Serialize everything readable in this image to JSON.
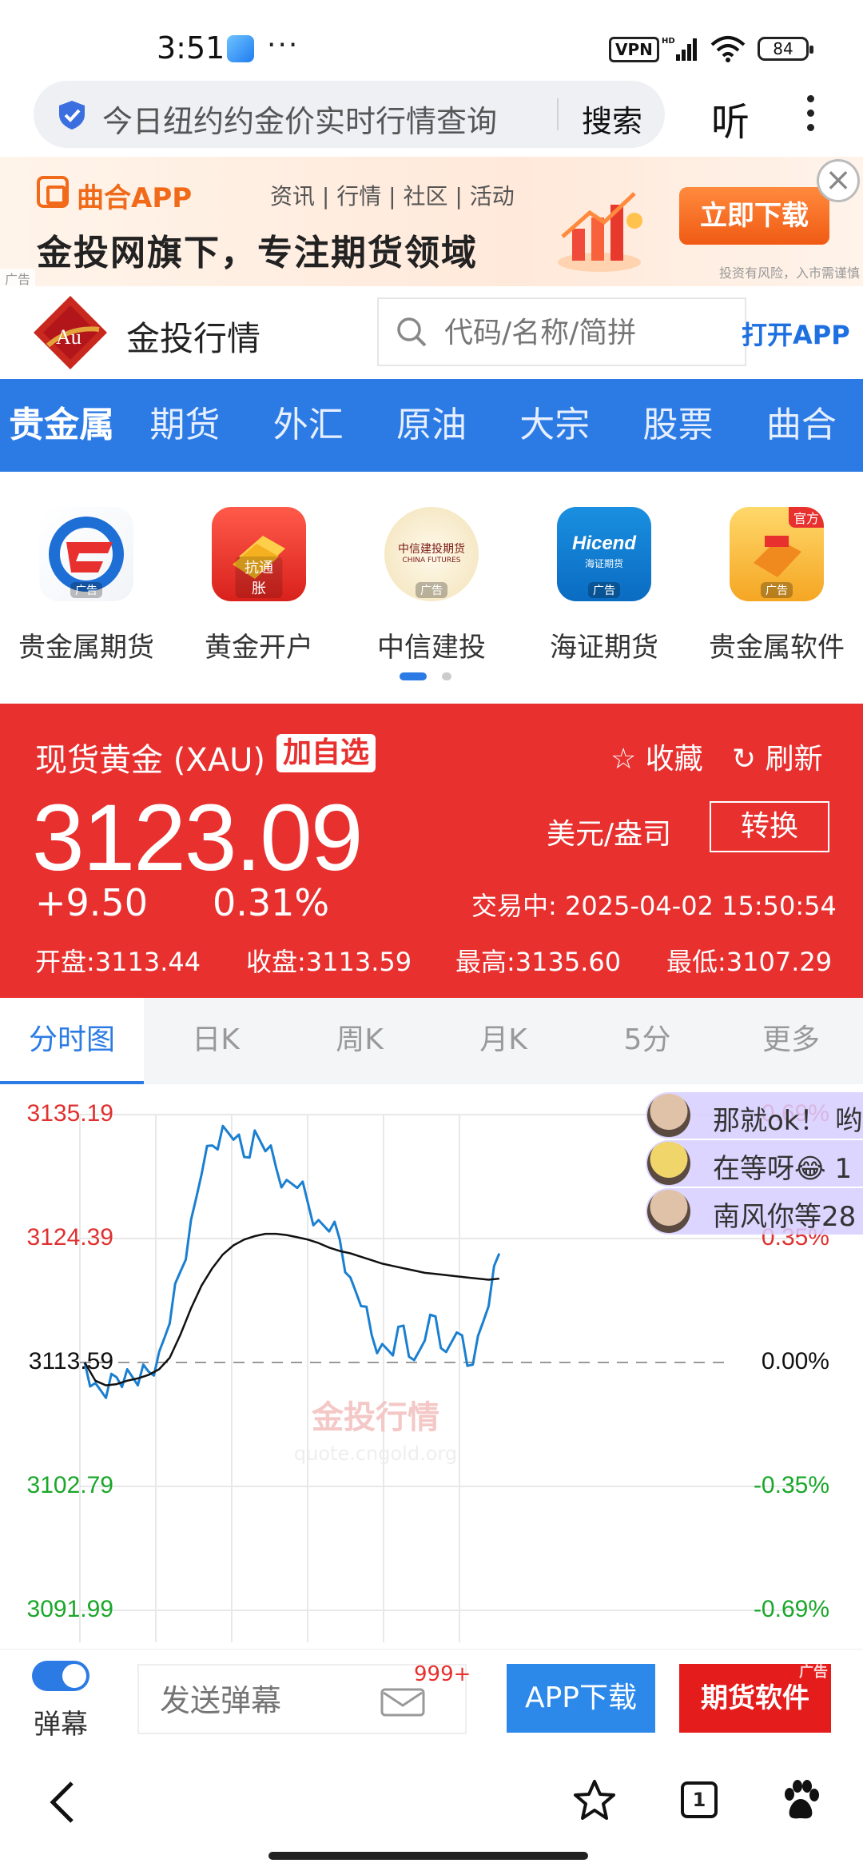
{
  "status_bar": {
    "time": "3:51",
    "dots": "···",
    "vpn": "VPN",
    "battery": "84"
  },
  "browser": {
    "query": "今日纽约约金价实时行情查询",
    "search_label": "搜索",
    "listen_label": "听"
  },
  "ad_banner": {
    "brand": "曲合APP",
    "tags": "资讯 | 行情 | 社区 | 活动",
    "slogan": "金投网旗下，专注期货领域",
    "cta": "立即下载",
    "ad_mark": "广告",
    "risk_note": "投资有风险，入市需谨慎"
  },
  "site": {
    "logo_text": "Au",
    "name": "金投行情",
    "search_placeholder": "代码/名称/简拼",
    "open_app": "打开APP"
  },
  "categories": [
    {
      "label": "贵金属",
      "active": true
    },
    {
      "label": "期货",
      "active": false
    },
    {
      "label": "外汇",
      "active": false
    },
    {
      "label": "原油",
      "active": false
    },
    {
      "label": "大宗",
      "active": false
    },
    {
      "label": "股票",
      "active": false
    },
    {
      "label": "曲合",
      "active": false
    }
  ],
  "icon_grid": [
    {
      "label": "贵金属期货",
      "tag": "广告",
      "icon": "precious-metal-futures-icon"
    },
    {
      "label": "黄金开户",
      "tag": "抗通胀",
      "icon": "gold-bar-icon"
    },
    {
      "label": "中信建投",
      "tag": "广告",
      "icon": "citic-futures-icon",
      "caption": "中信建投期货",
      "caption_en": "CHINA FUTURES"
    },
    {
      "label": "海证期货",
      "tag": "广告",
      "icon": "hicend-icon",
      "caption": "Hicend",
      "caption_sub": "海证期货"
    },
    {
      "label": "贵金属软件",
      "tag": "广告",
      "icon": "gold-software-icon",
      "badge": "官方"
    }
  ],
  "quote": {
    "name": "现货黄金 (XAU)",
    "add_label": "加自选",
    "fav_label": "收藏",
    "refresh_label": "刷新",
    "price": "3123.09",
    "unit": "美元/盎司",
    "convert_label": "转换",
    "change": "+9.50",
    "change_pct": "0.31%",
    "status": "交易中:  2025-04-02 15:50:54",
    "open": "开盘:3113.44",
    "close": "收盘:3113.59",
    "high": "最高:3135.60",
    "low": "最低:3107.29"
  },
  "chart_tabs": [
    {
      "label": "分时图",
      "active": true
    },
    {
      "label": "日K",
      "active": false
    },
    {
      "label": "周K",
      "active": false
    },
    {
      "label": "月K",
      "active": false
    },
    {
      "label": "5分",
      "active": false
    },
    {
      "label": "更多",
      "active": false
    }
  ],
  "chart_data": {
    "type": "line",
    "title": "",
    "y_ticks": [
      "3135.19",
      "3124.39",
      "3113.59",
      "3102.79",
      "3091.99"
    ],
    "pct_ticks": [
      "0.69%",
      "0.35%",
      "0.00%",
      "-0.35%",
      "-0.69%"
    ],
    "ylim": [
      3091.99,
      3135.19
    ],
    "baseline": 3113.59,
    "watermark": "金投行情",
    "watermark_url": "quote.cngold.org",
    "colors": {
      "price": "#1a7fd0",
      "average": "#111111",
      "up": "#e0302f",
      "down": "#1aa72a"
    },
    "series": [
      {
        "values": [
          3113.6,
          3111.8,
          3110.5,
          3112.3,
          3113.0,
          3111.6,
          3112.8,
          3114.5,
          3117.0,
          3121.5,
          3126.0,
          3130.0,
          3132.5,
          3134.2,
          3133.0,
          3131.5,
          3133.8,
          3132.0,
          3130.6,
          3129.5,
          3128.8,
          3127.5,
          3126.0,
          3125.0,
          3124.3,
          3121.0,
          3118.5,
          3116.0,
          3115.2,
          3114.2,
          3116.8,
          3113.8,
          3115.5,
          3117.6,
          3114.5,
          3116.2,
          3113.3,
          3115.9,
          3118.5,
          3123.09
        ]
      },
      {
        "values": [
          3113.6,
          3112.0,
          3111.6,
          3111.7,
          3112.0,
          3112.2,
          3112.5,
          3113.0,
          3114.0,
          3116.0,
          3118.3,
          3120.3,
          3121.8,
          3123.0,
          3123.8,
          3124.3,
          3124.6,
          3124.8,
          3124.8,
          3124.7,
          3124.5,
          3124.3,
          3124.0,
          3123.6,
          3123.3,
          3123.1,
          3122.8,
          3122.5,
          3122.2,
          3122.0,
          3121.8,
          3121.6,
          3121.4,
          3121.3,
          3121.2,
          3121.1,
          3121.0,
          3120.9,
          3120.8,
          3120.9
        ]
      }
    ]
  },
  "danmaku": [
    {
      "text": "那就ok！ 哟"
    },
    {
      "text": "在等呀😂 1"
    },
    {
      "text": "南风你等28"
    }
  ],
  "bottom_bar": {
    "toggle_label": "弹幕",
    "input_placeholder": "发送弹幕",
    "badge": "999+",
    "app_download": "APP下载",
    "futures_software": "期货软件",
    "ad_tag": "广告"
  },
  "browser_nav": {
    "tab_count": "1"
  }
}
